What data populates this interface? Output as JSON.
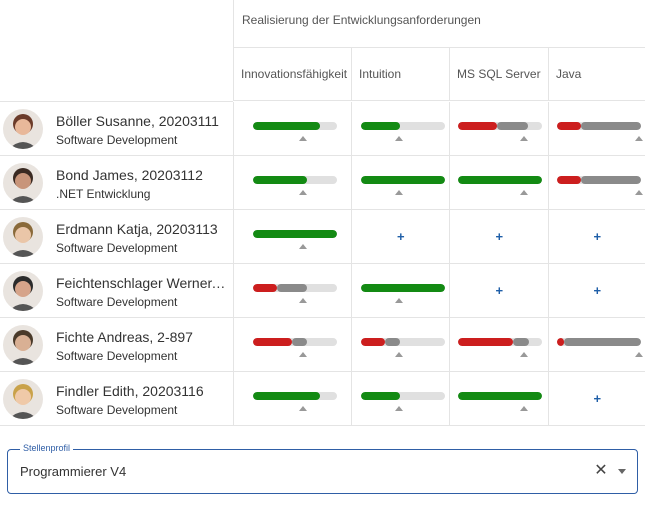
{
  "header": {
    "group_title": "Realisierung der Entwicklungsanforderungen",
    "columns": [
      "Innovationsfähigkeit",
      "Intuition",
      "MS SQL Server",
      "Java"
    ]
  },
  "colors": {
    "green": "#138a13",
    "red": "#cc1e1e",
    "gray": "#8a8a8a",
    "track": "#e0e0e0",
    "accent": "#2f5ea6"
  },
  "rows": [
    {
      "name": "Böller Susanne, 20203111",
      "department": "Software Development",
      "cells": [
        {
          "type": "bar",
          "green": 0.8,
          "red": 0,
          "gray": 0,
          "marker": 0.6
        },
        {
          "type": "bar",
          "green": 0.47,
          "red": 0,
          "gray": 0,
          "marker": 0.45
        },
        {
          "type": "bar",
          "green": 0,
          "red": 0.47,
          "gray": 0.36,
          "marker": 0.78
        },
        {
          "type": "bar",
          "green": 0,
          "red": 0.28,
          "gray": 0.72,
          "marker": 0.98
        }
      ]
    },
    {
      "name": "Bond James, 20203112",
      "department": ".NET Entwicklung",
      "cells": [
        {
          "type": "bar",
          "green": 0.64,
          "red": 0,
          "gray": 0,
          "marker": 0.6
        },
        {
          "type": "bar",
          "green": 1.0,
          "red": 0,
          "gray": 0,
          "marker": 0.45
        },
        {
          "type": "bar",
          "green": 1.0,
          "red": 0,
          "gray": 0,
          "marker": 0.78
        },
        {
          "type": "bar",
          "green": 0,
          "red": 0.28,
          "gray": 0.72,
          "marker": 0.98
        }
      ]
    },
    {
      "name": "Erdmann Katja, 20203113",
      "department": "Software Development",
      "cells": [
        {
          "type": "bar",
          "green": 1.0,
          "red": 0,
          "gray": 0,
          "marker": 0.6
        },
        {
          "type": "plus",
          "label": "+"
        },
        {
          "type": "plus",
          "label": "+"
        },
        {
          "type": "plus",
          "label": "+"
        }
      ]
    },
    {
      "name": "Feichtenschlager Werner, 4...",
      "department": "Software Development",
      "cells": [
        {
          "type": "bar",
          "green": 0,
          "red": 0.28,
          "gray": 0.36,
          "marker": 0.6
        },
        {
          "type": "bar",
          "green": 1.0,
          "red": 0,
          "gray": 0,
          "marker": 0.45
        },
        {
          "type": "plus",
          "label": "+"
        },
        {
          "type": "plus",
          "label": "+"
        }
      ]
    },
    {
      "name": "Fichte Andreas, 2-897",
      "department": "Software Development",
      "cells": [
        {
          "type": "bar",
          "green": 0,
          "red": 0.46,
          "gray": 0.18,
          "marker": 0.6
        },
        {
          "type": "bar",
          "green": 0,
          "red": 0.28,
          "gray": 0.18,
          "marker": 0.45
        },
        {
          "type": "bar",
          "green": 0,
          "red": 0.66,
          "gray": 0.18,
          "marker": 0.78
        },
        {
          "type": "bar",
          "green": 0,
          "red": 0.08,
          "gray": 0.92,
          "marker": 0.98
        }
      ]
    },
    {
      "name": "Findler Edith, 20203116",
      "department": "Software Development",
      "cells": [
        {
          "type": "bar",
          "green": 0.8,
          "red": 0,
          "gray": 0,
          "marker": 0.6
        },
        {
          "type": "bar",
          "green": 0.47,
          "red": 0,
          "gray": 0,
          "marker": 0.45
        },
        {
          "type": "bar",
          "green": 1.0,
          "red": 0,
          "gray": 0,
          "marker": 0.78
        },
        {
          "type": "plus",
          "label": "+"
        }
      ]
    }
  ],
  "field": {
    "label": "Stellenprofil",
    "value": "Programmierer V4"
  }
}
